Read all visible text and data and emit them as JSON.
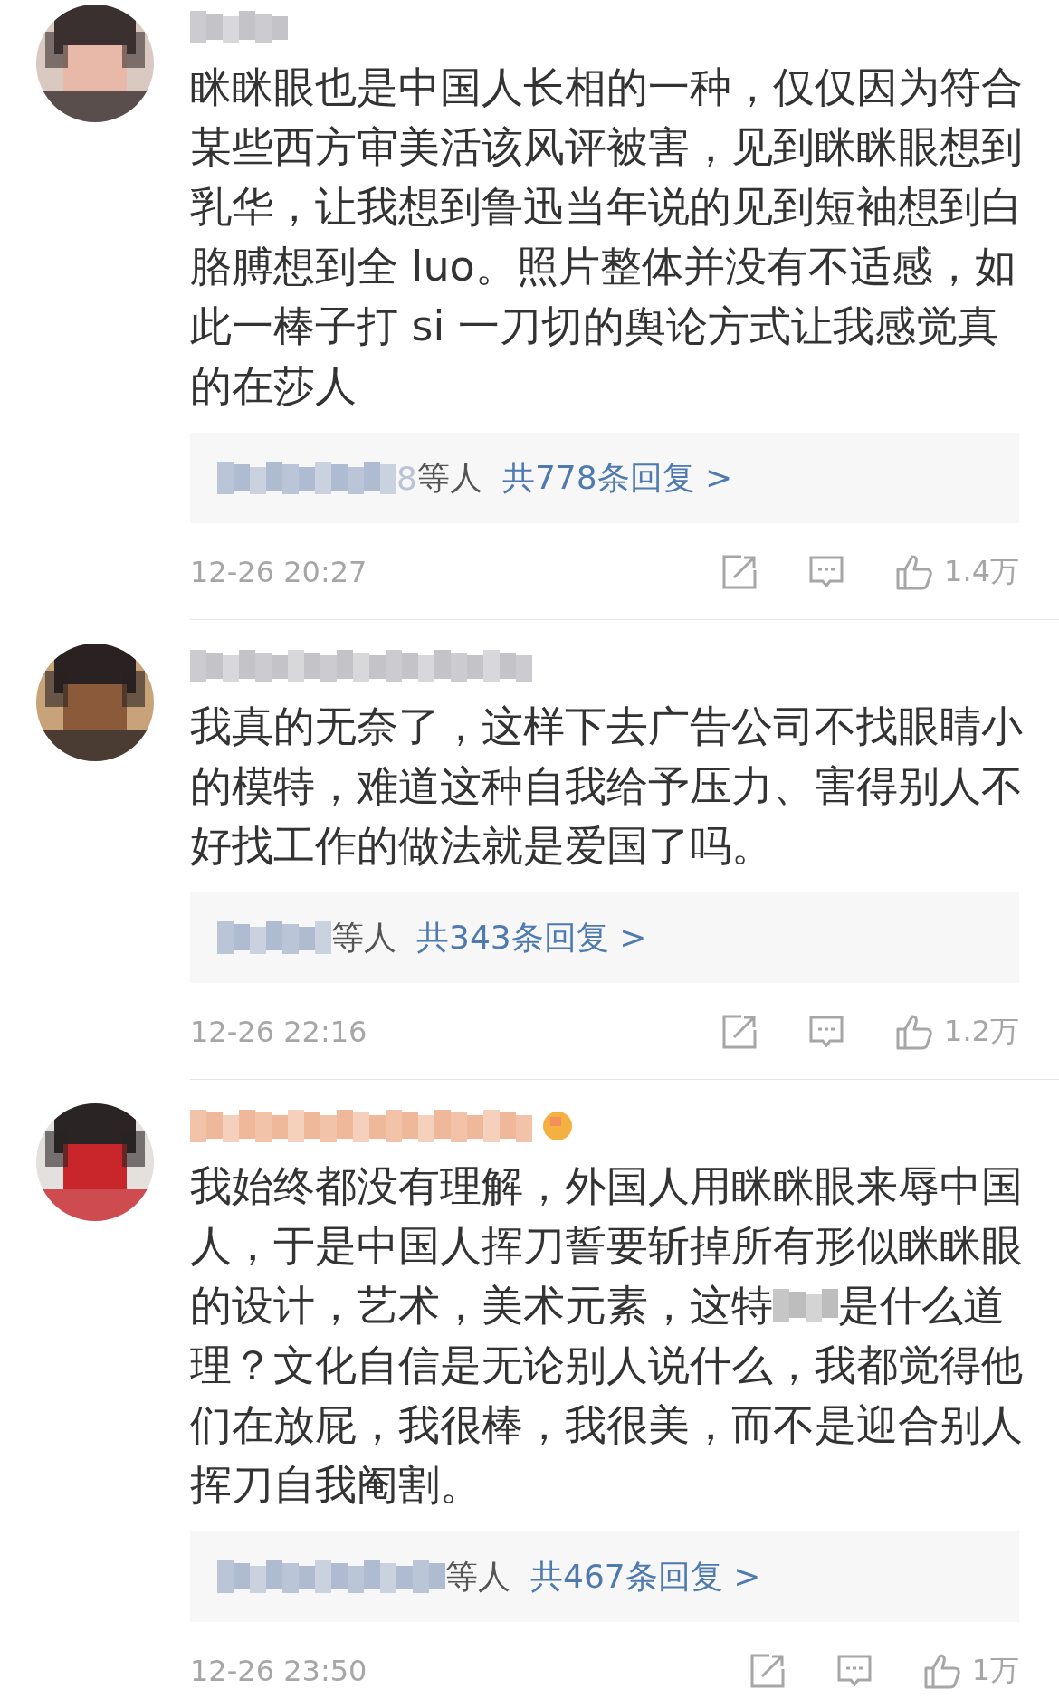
{
  "comments": [
    {
      "user": {
        "color": "#c4c4c8",
        "emoji": false
      },
      "text_blocks": [
        [
          "眯眯眼也是中国人长相的一种，仅仅因为符合某些西方审美活该风评被害，见到眯眯眼想到乳华，让我想到鲁迅当年说的见到短袖想到白胳膊想到全 luo。照片整体并没有不适感，如此一棒子打 si 一刀切的舆论方式让我感觉真的在莎人"
        ]
      ],
      "replies": {
        "name_end": "8",
        "tail": "等人",
        "link": "共778条回复 >"
      },
      "time": "12-26 20:27",
      "likes": "1.4万"
    },
    {
      "user": {
        "color": "#c4c4c8",
        "emoji": false
      },
      "text_blocks": [
        [
          "我真的无奈了，这样下去广告公司不找眼睛小的模特，难道这种自我给予压力、害得别人不好找工作的做法就是爱国了吗。"
        ]
      ],
      "replies": {
        "tail": "等人",
        "link": "共343条回复 >"
      },
      "time": "12-26 22:16",
      "likes": "1.2万"
    },
    {
      "user": {
        "color": "#f0b89a",
        "emoji": true
      },
      "text_blocks": [
        [
          "我始终都没有理解，外国人用眯眯眼来辱中国人，于是中国人挥刀誓要斩掉所有形似眯眯眼"
        ],
        [
          "的设计，艺术，美术元素，这特",
          "是什么道"
        ],
        [
          "理？文化自信是无论别人说什么，我都觉得他们在放屁，我很棒，我很美，而不是迎合别人挥刀自我阉割。"
        ]
      ],
      "replies": {
        "tail": "等人",
        "link": "共467条回复 >"
      },
      "time": "12-26 23:50",
      "likes": "1万"
    }
  ]
}
